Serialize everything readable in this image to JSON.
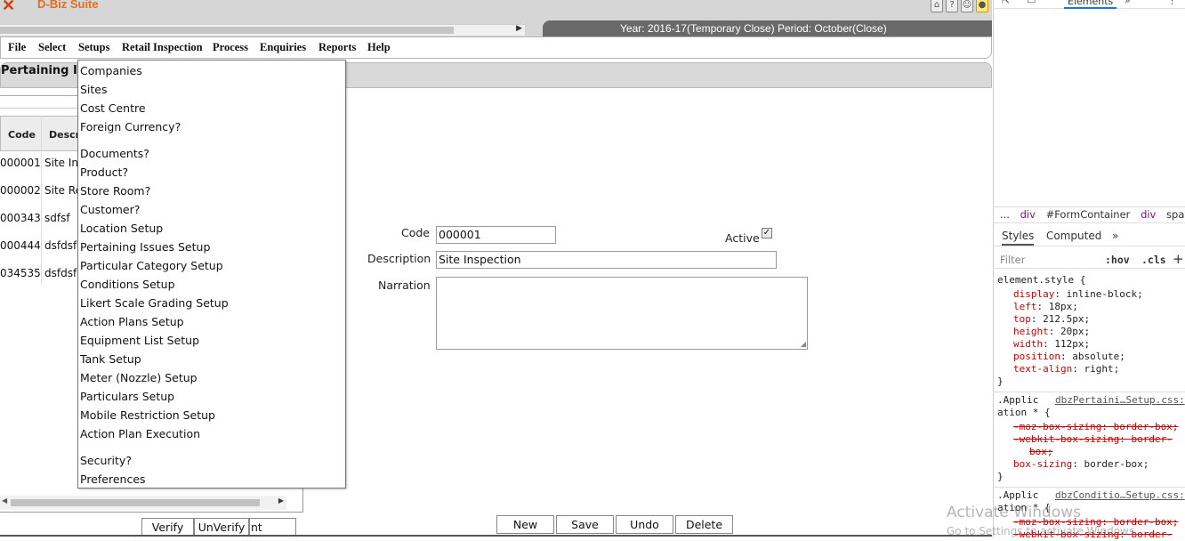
{
  "app": {
    "logo_text": "D-Biz Suite",
    "year_period": "Year: 2016-17(Temporary Close) Period: October(Close)"
  },
  "menubar": [
    "File",
    "Select",
    "Setups",
    "Retail Inspection",
    "Process",
    "Enquiries",
    "Reports",
    "Help"
  ],
  "form": {
    "title": "Pertaining Is",
    "code_label": "Code",
    "code_value": "000001",
    "active_label": "Active",
    "active_checked": true,
    "description_label": "Description",
    "description_value": "Site Inspection",
    "narration_label": "Narration",
    "narration_value": ""
  },
  "grid": {
    "headers": [
      "Code",
      "Descr"
    ],
    "rows": [
      {
        "code": "000001",
        "desc": "Site Ins"
      },
      {
        "code": "000002",
        "desc": "Site Re"
      },
      {
        "code": "000343",
        "desc": "sdfsf"
      },
      {
        "code": "000444",
        "desc": "dsfdsf"
      },
      {
        "code": "034535",
        "desc": "dsfdsf"
      }
    ]
  },
  "dropdown": {
    "items": [
      "Companies",
      "Sites",
      "Cost Centre",
      "Foreign Currency?",
      "Documents?",
      "Product?",
      "Store Room?",
      "Customer?",
      "Location Setup",
      "Pertaining Issues Setup",
      "Particular Category Setup",
      "Conditions Setup",
      "Likert Scale Grading Setup",
      "Action Plans Setup",
      "Equipment List Setup",
      "Tank Setup",
      "Meter (Nozzle) Setup",
      "Particulars Setup",
      "Mobile Restriction Setup",
      "Action Plan Execution",
      "Security?",
      "Preferences"
    ]
  },
  "buttons": {
    "verify": "Verify",
    "unverify": "UnVerify",
    "hidden_suffix": "nt",
    "new": "New",
    "save": "Save",
    "undo": "Undo",
    "delete": "Delete"
  },
  "devtools": {
    "top_tab": "Elements",
    "breadcrumb": [
      "...",
      "div",
      "#FormContainer",
      "div",
      "span"
    ],
    "tabs": [
      "Styles",
      "Computed",
      "»"
    ],
    "filter_placeholder": "Filter",
    "hov": ":hov",
    "cls": ".cls",
    "element_style_selector": "element.style {",
    "element_style": [
      {
        "prop": "display",
        "val": "inline-block;"
      },
      {
        "prop": "left",
        "val": "18px;"
      },
      {
        "prop": "top",
        "val": "212.5px;"
      },
      {
        "prop": "height",
        "val": "20px;"
      },
      {
        "prop": "width",
        "val": "112px;"
      },
      {
        "prop": "position",
        "val": "absolute;"
      },
      {
        "prop": "text-align",
        "val": "right;"
      }
    ],
    "close_brace": "}",
    "rule1_selector_a": ".Applic",
    "rule1_selector_b": "ation * {",
    "rule1_source": "dbzPertaini…Setup.css:",
    "rule1_strike1": "-moz-box-sizing: border-box;",
    "rule1_strike2a": "-webkit-box-sizing: border-",
    "rule1_strike2b": "box;",
    "rule1_prop": "box-sizing",
    "rule1_val": "border-box;",
    "rule2_selector_a": ".Applic",
    "rule2_selector_b": "ation * {",
    "rule2_source": "dbzConditio…Setup.css:",
    "rule2_strike1": "-moz-box-sizing: border-box;",
    "rule2_strike2": "-webkit-box-sizing: border-"
  },
  "watermark": {
    "line1": "Activate Windows",
    "line2": "Go to Settings to activate Windows."
  }
}
